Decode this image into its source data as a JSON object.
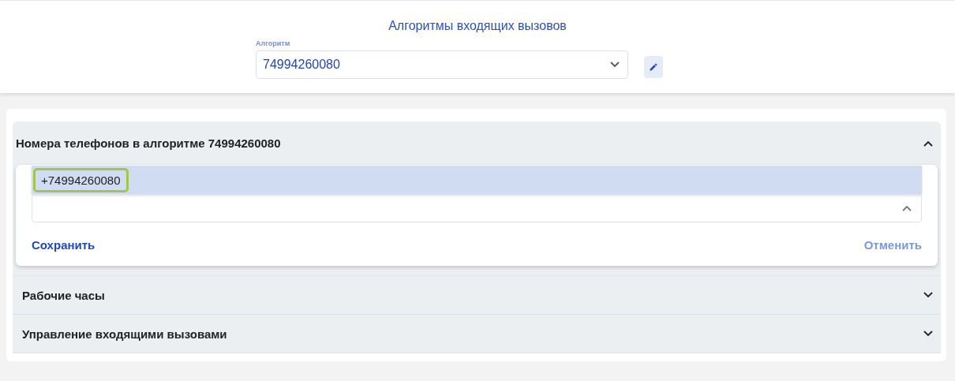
{
  "header": {
    "title": "Алгоритмы входящих вызовов",
    "algorithm_select": {
      "label": "Алгоритм",
      "value": "74994260080"
    }
  },
  "sections": [
    {
      "title": "Номера телефонов в алгоритме 74994260080",
      "expanded": true,
      "options": [
        {
          "label": "+74994260080",
          "selected": true,
          "outlined": true
        }
      ],
      "open_dropdown": true,
      "save": "Сохранить",
      "cancel": "Отменить"
    },
    {
      "title": "Рабочие часы",
      "expanded": false
    },
    {
      "title": "Управление входящими вызовами",
      "expanded": false
    }
  ]
}
